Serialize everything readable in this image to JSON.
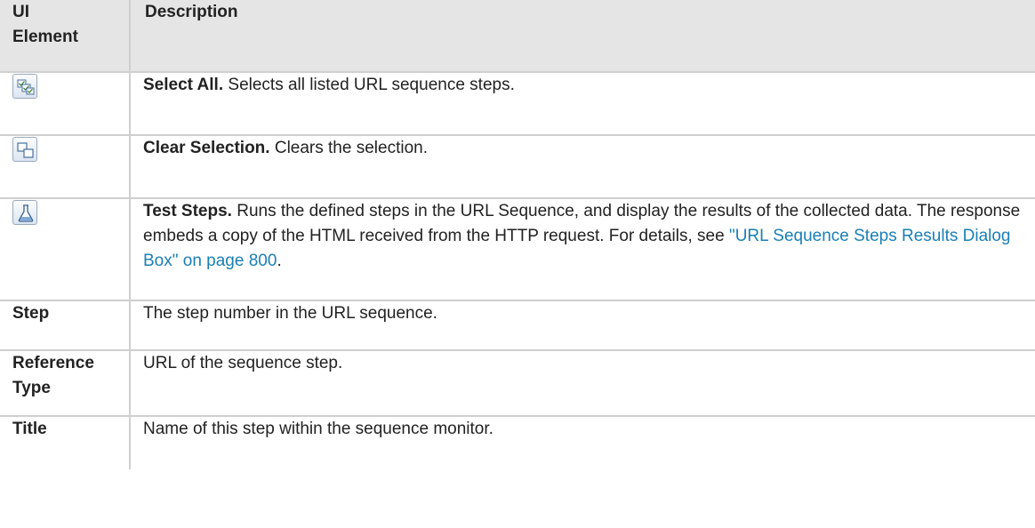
{
  "header": {
    "col1": "UI\nElement",
    "col1_line1": "UI",
    "col1_line2": "Element",
    "col2": "Description"
  },
  "rows": [
    {
      "icon": "select-all-icon",
      "term": "Select All.",
      "text": " Selects all listed URL sequence steps."
    },
    {
      "icon": "clear-selection-icon",
      "term": "Clear Selection.",
      "text": " Clears the selection."
    },
    {
      "icon": "test-steps-flask-icon",
      "term": "Test Steps.",
      "text": " Runs the defined steps in the URL Sequence, and display the results of the collected data. The response embeds a copy of the HTML received from the HTTP request. For details, see ",
      "link": "\"URL Sequence Steps Results Dialog Box\" on page 800",
      "after": "."
    },
    {
      "element": "Step",
      "text": "The step number in the URL sequence."
    },
    {
      "element": "Reference Type",
      "text": "URL of the sequence step."
    },
    {
      "element": "Title",
      "text": "Name of this step within the sequence monitor."
    }
  ],
  "colors": {
    "header_bg": "#e5e5e5",
    "border": "#cfcfcf",
    "link": "#1a7fb5"
  }
}
